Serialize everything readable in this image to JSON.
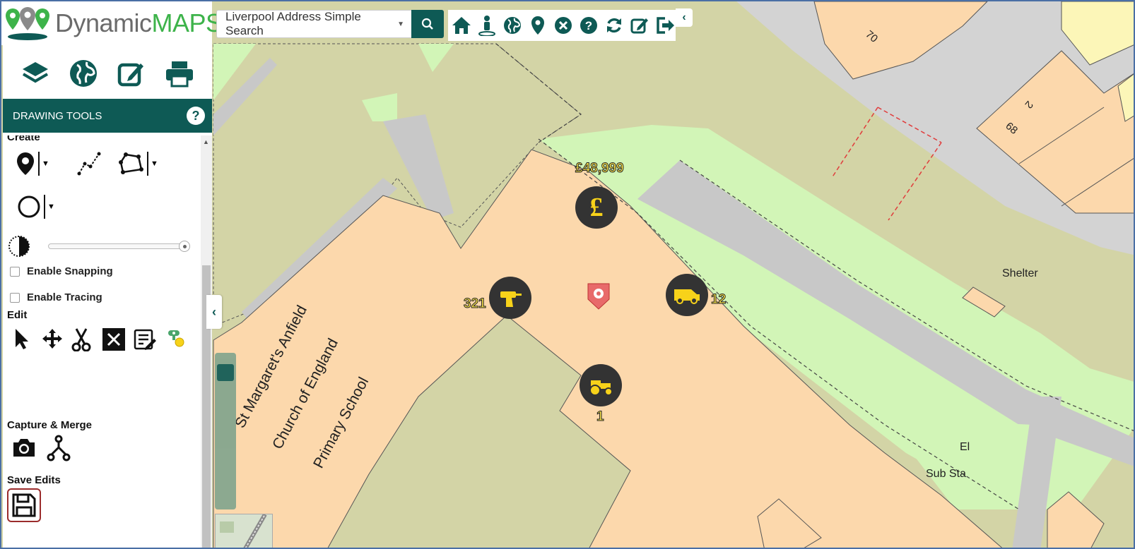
{
  "app": {
    "logo_part1": "Dynamic",
    "logo_part2": "MAPS"
  },
  "search": {
    "selected_option": "Liverpool Address Simple Search"
  },
  "toolbar_icons": [
    "home-icon",
    "person-pin-icon",
    "globe-icon",
    "map-marker-icon",
    "close-circle-icon",
    "help-icon",
    "refresh-icon",
    "edit-icon",
    "logout-icon"
  ],
  "panel_main_icons": [
    "layers-icon",
    "globe-icon",
    "edit-icon",
    "print-icon"
  ],
  "drawing_tools": {
    "header": "DRAWING TOOLS",
    "help": "?",
    "create_title": "Create",
    "enable_snapping": "Enable Snapping",
    "enable_tracing": "Enable Tracing",
    "edit_title": "Edit",
    "capture_title": "Capture & Merge",
    "save_title": "Save Edits"
  },
  "map": {
    "labels": {
      "school_line1": "St Margaret's Anfield",
      "school_line2": "Church of England",
      "school_line3": "Primary School",
      "shelter": "Shelter",
      "el": "El",
      "substa": "Sub Sta",
      "num70": "70",
      "num68": "68",
      "num2": "2"
    },
    "markers": {
      "money_value": "£48,999",
      "drill_value": "321",
      "van_value": "12",
      "tractor_value": "1"
    },
    "colors": {
      "building": "#fcd8ac",
      "land": "#d3d4a6",
      "green": "#d2f5b7",
      "road": "#d3d3d3",
      "accent": "#0e5a55",
      "marker_yellow": "#f7d21a"
    }
  }
}
